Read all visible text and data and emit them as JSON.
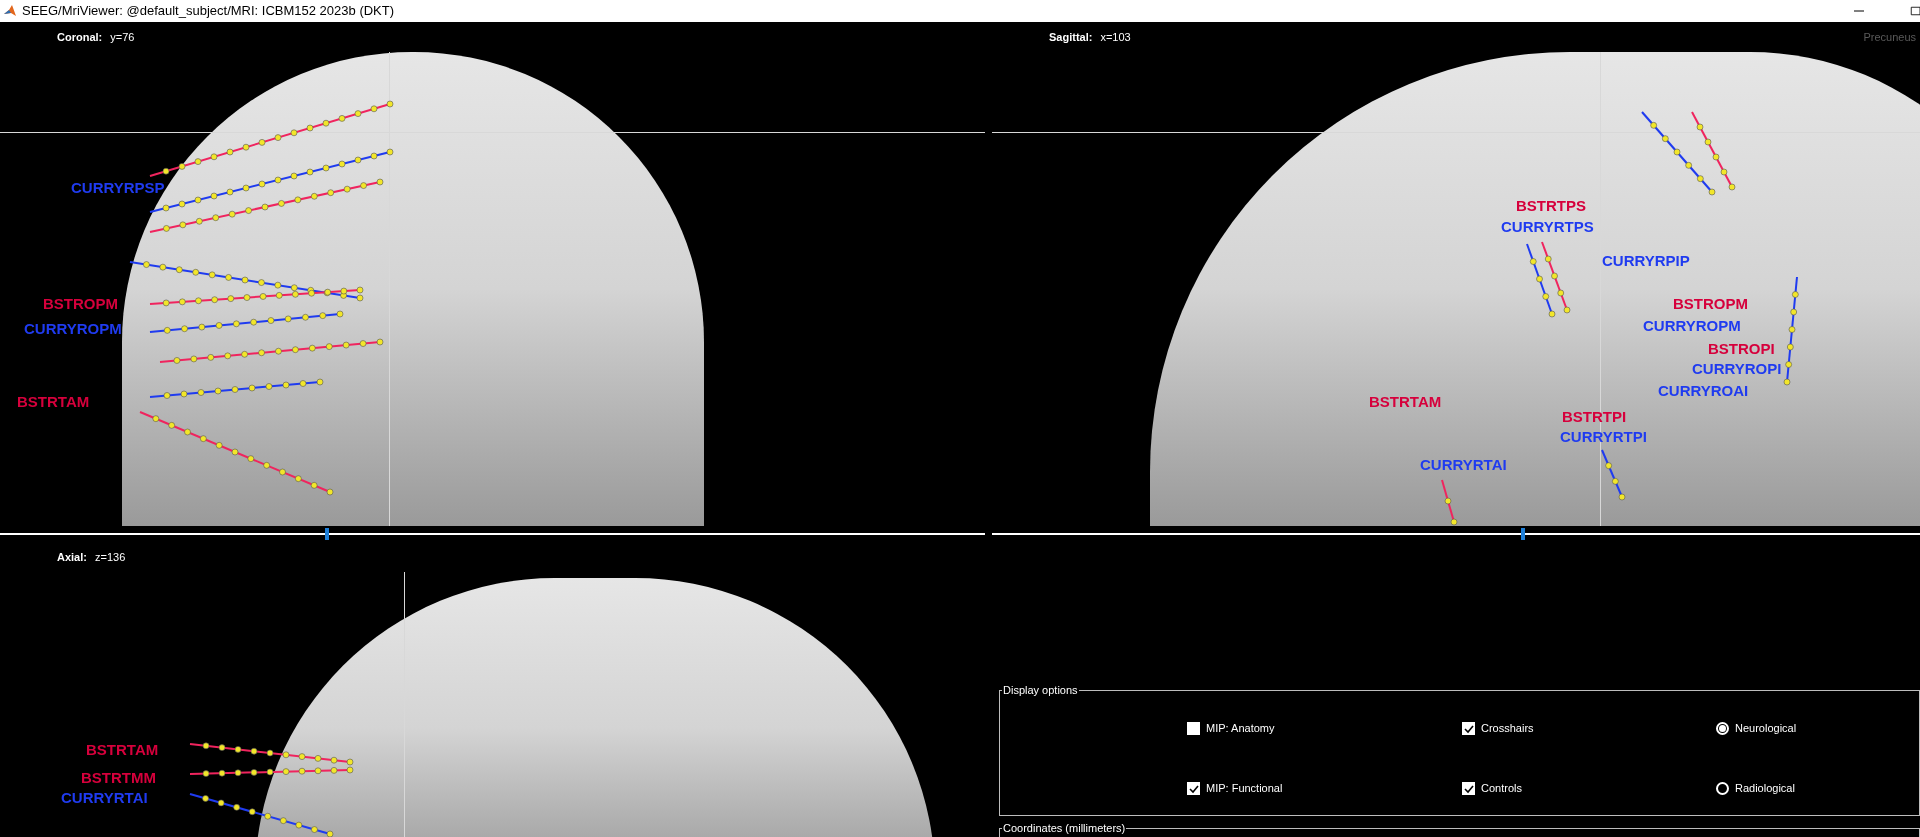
{
  "window": {
    "title": "SEEG/MriViewer: @default_subject/MRI: ICBM152 2023b (DKT)"
  },
  "views": [
    {
      "name": "Coronal:",
      "coordinate": "y=76",
      "slider": {
        "level": 0.33
      },
      "electrode_labels": [
        {
          "text": "CURRYRPSP",
          "color": "#1f3bf0"
        },
        {
          "text": "BSTROPM",
          "color": "#d6003c"
        },
        {
          "text": "CURRYROPM",
          "color": "#1f3bf0"
        },
        {
          "text": "BSTRTAM",
          "color": "#d6003c"
        }
      ]
    },
    {
      "name": "Sagittal:",
      "coordinate": "x=103",
      "slider": {
        "level": 0.57
      },
      "electrode_labels": [
        {
          "text": "BSTRTPS",
          "color": "#d6003c"
        },
        {
          "text": "CURRYRTPS",
          "color": "#1f3bf0"
        },
        {
          "text": "CURRYRPIP",
          "color": "#1f3bf0"
        },
        {
          "text": "BSTROPM",
          "color": "#d6003c"
        },
        {
          "text": "CURRYROPM",
          "color": "#1f3bf0"
        },
        {
          "text": "BSTROPI",
          "color": "#d6003c"
        },
        {
          "text": "CURRYROPI",
          "color": "#1f3bf0"
        },
        {
          "text": "CURRYROAI",
          "color": "#1f3bf0"
        },
        {
          "text": "BSTRTAM",
          "color": "#d6003c"
        },
        {
          "text": "BSTRTPI",
          "color": "#d6003c"
        },
        {
          "text": "CURRYRTPI",
          "color": "#1f3bf0"
        },
        {
          "text": "CURRYRTAI",
          "color": "#1f3bf0"
        }
      ]
    },
    {
      "name": "Axial:",
      "coordinate": "z=136",
      "electrode_labels": [
        {
          "text": "BSTRTAM",
          "color": "#d6003c"
        },
        {
          "text": "BSTRTMM",
          "color": "#d6003c"
        },
        {
          "text": "CURRYRTAI",
          "color": "#1f3bf0"
        }
      ]
    }
  ],
  "atlas_label": "Precuneus",
  "display_options": {
    "title": "Display options",
    "options": [
      {
        "kind": "checkbox",
        "label": "MIP: Anatomy",
        "checked": false
      },
      {
        "kind": "checkbox",
        "label": "Crosshairs",
        "checked": true
      },
      {
        "kind": "radio",
        "label": "Neurological",
        "selected": true
      },
      {
        "kind": "checkbox",
        "label": "MIP: Functional",
        "checked": true
      },
      {
        "kind": "checkbox",
        "label": "Controls",
        "checked": true
      },
      {
        "kind": "radio",
        "label": "Radiological",
        "selected": false
      }
    ]
  },
  "coordinates_panel": {
    "title": "Coordinates (millimeters)"
  }
}
